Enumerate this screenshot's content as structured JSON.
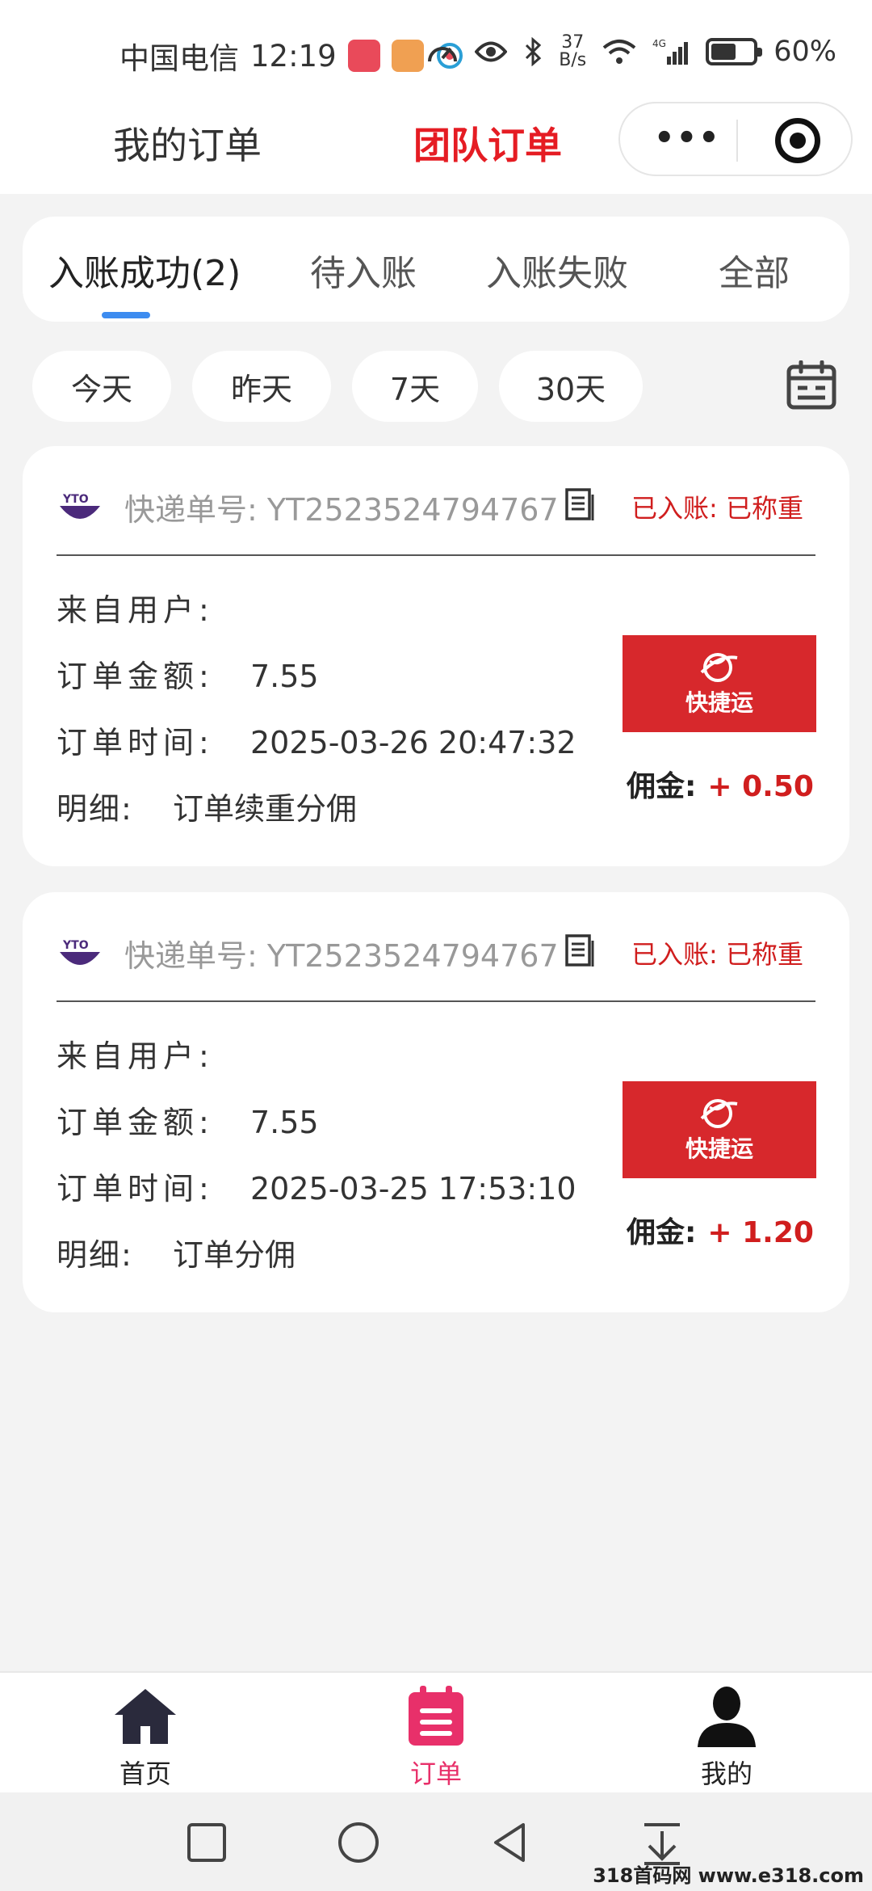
{
  "status_bar": {
    "carrier": "中国电信",
    "time": "12:19",
    "net_speed_value": "37",
    "net_speed_unit": "B/s",
    "network_type": "4G",
    "battery_percent": "60%",
    "battery_level": 0.6
  },
  "header": {
    "tab_mine": "我的订单",
    "tab_team": "团队订单",
    "menu_dots": "•••"
  },
  "status_tabs": [
    {
      "label": "入账成功(2)",
      "active": true
    },
    {
      "label": "待入账",
      "active": false
    },
    {
      "label": "入账失败",
      "active": false
    },
    {
      "label": "全部",
      "active": false
    }
  ],
  "date_filters": [
    "今天",
    "昨天",
    "7天",
    "30天"
  ],
  "orders": [
    {
      "carrier_logo_text": "YTO",
      "tracking_label": "快递单号:",
      "tracking_number": "YT2523524794767",
      "status": "已入账: 已称重",
      "from_user_label": "来自用户:",
      "from_user": "",
      "amount_label": "订单金额:",
      "amount": "7.55",
      "time_label": "订单时间:",
      "time": "2025-03-26 20:47:32",
      "detail_label": "明细:",
      "detail": "订单续重分佣",
      "brand": "快捷运",
      "commission_label": "佣金:",
      "commission": "+ 0.50"
    },
    {
      "carrier_logo_text": "YTO",
      "tracking_label": "快递单号:",
      "tracking_number": "YT2523524794767",
      "status": "已入账: 已称重",
      "from_user_label": "来自用户:",
      "from_user": "",
      "amount_label": "订单金额:",
      "amount": "7.55",
      "time_label": "订单时间:",
      "time": "2025-03-25 17:53:10",
      "detail_label": "明细:",
      "detail": "订单分佣",
      "brand": "快捷运",
      "commission_label": "佣金:",
      "commission": "+ 1.20"
    }
  ],
  "bottom_nav": [
    {
      "label": "首页",
      "icon": "home-icon",
      "active": false
    },
    {
      "label": "订单",
      "icon": "order-list-icon",
      "active": true
    },
    {
      "label": "我的",
      "icon": "user-icon",
      "active": false
    }
  ],
  "colors": {
    "accent_red": "#e51c23",
    "status_red": "#d01e1e",
    "tab_indicator": "#3d8cf0",
    "nav_active": "#e8306a",
    "brand_red": "#d7282c"
  },
  "watermark": "318首码网 www.e318.com"
}
